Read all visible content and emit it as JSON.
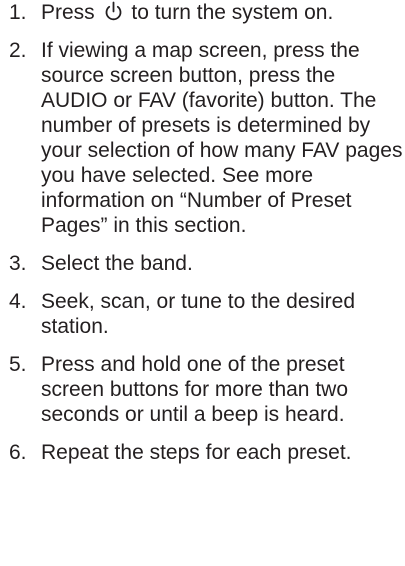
{
  "steps": [
    {
      "num": "1.",
      "before_icon": "Press",
      "icon": "power-icon",
      "after_icon": "to turn the system on."
    },
    {
      "num": "2.",
      "text": "If viewing a map screen, press the source screen button, press the AUDIO or FAV (favorite) button. The number of presets is determined by your selection of how many FAV pages you have selected. See more information on “Number of Preset Pages” in this section."
    },
    {
      "num": "3.",
      "text": "Select the band."
    },
    {
      "num": "4.",
      "text": "Seek, scan, or tune to the desired station."
    },
    {
      "num": "5.",
      "text": "Press and hold one of the preset screen buttons for more than two seconds or until a beep is heard."
    },
    {
      "num": "6.",
      "text": "Repeat the steps for each preset."
    }
  ]
}
